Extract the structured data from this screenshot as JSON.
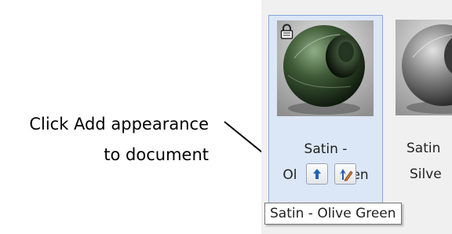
{
  "callout": {
    "line1": "Click Add appearance",
    "line2": "to document"
  },
  "appearances": [
    {
      "name_line1": "Satin -",
      "name_line2": "Olive Green",
      "name_left": "Ol",
      "name_right": "en",
      "locked": true,
      "selected": true,
      "color": "#3e5a36"
    },
    {
      "name_line1": "Satin",
      "name_line2": "Silve",
      "color": "#8a8a8a"
    }
  ],
  "tooltip": "Satin - Olive Green",
  "icons": {
    "lock": "lock-icon",
    "add": "add-to-document-icon",
    "edit": "edit-appearance-icon",
    "arrow": "callout-arrow"
  }
}
